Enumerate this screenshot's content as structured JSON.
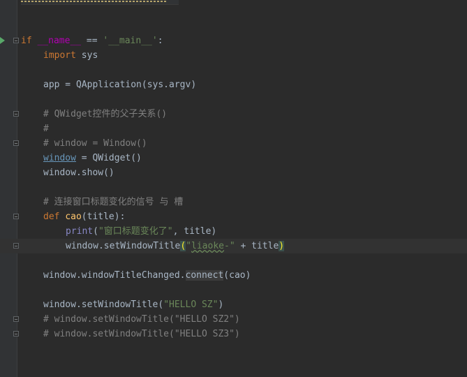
{
  "editor": {
    "language": "Python",
    "theme_colors": {
      "background": "#2b2b2b",
      "keyword": "#cc7832",
      "string": "#6a8759",
      "comment": "#808080",
      "function": "#ffc66d",
      "builtin": "#8888c6",
      "variable_underlined": "#6897bb",
      "run_marker": "#59a869"
    },
    "lines": {
      "l1": {
        "kw_if": "if",
        "dunder": " __name__",
        "op": " == ",
        "str": "'__main__'",
        "colon": ":"
      },
      "l2": {
        "kw": "import",
        "rest": " sys"
      },
      "l3": {
        "text": "app = QApplication(sys.argv)"
      },
      "l4": {
        "comment": "# QWidget控件的父子关系()"
      },
      "l5": {
        "comment": "#"
      },
      "l6": {
        "comment": "# window = Window()"
      },
      "l7": {
        "var": "window",
        "rest": " = QWidget()"
      },
      "l8": {
        "text": "window.show()"
      },
      "l9": {
        "comment": "# 连接窗口标题变化的信号 与 槽"
      },
      "l10": {
        "kw": "def",
        "space": " ",
        "fn": "cao",
        "rest": "(title):"
      },
      "l11": {
        "bi": "print",
        "open": "(",
        "str": "\"窗口标题变化了\"",
        "rest": ", title)"
      },
      "l12": {
        "pre": "window.setWindowTitle",
        "open": "(",
        "q1": "\"",
        "typo": "liaoke",
        "str2": "-\"",
        "mid": " + title",
        "close": ")"
      },
      "l13": {
        "pre": "window.windowTitleChanged.",
        "call": "connect",
        "rest": "(cao)"
      },
      "l14": {
        "pre": "window.setWindowTitle(",
        "str": "\"HELLO SZ\"",
        "rest": ")"
      },
      "l15": {
        "comment": "# window.setWindowTitle(\"HELLO SZ2\")"
      },
      "l16": {
        "comment": "# window.setWindowTitle(\"HELLO SZ3\")"
      }
    }
  }
}
